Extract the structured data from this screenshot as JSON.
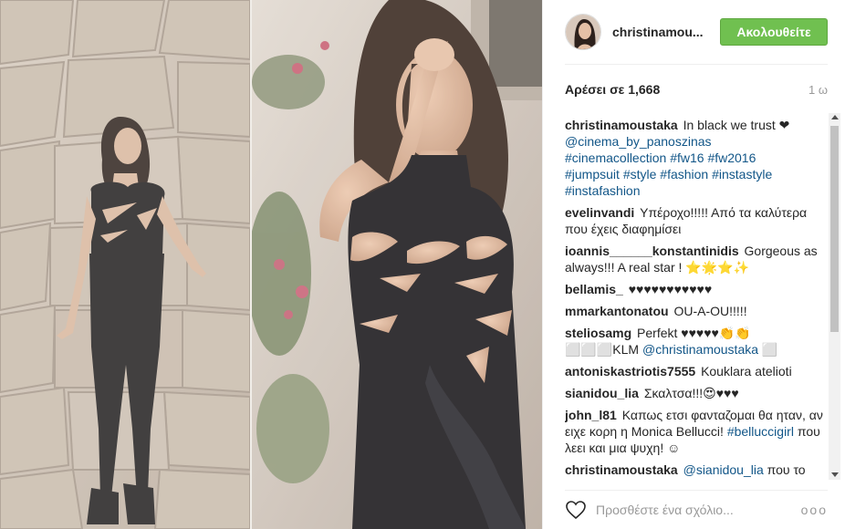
{
  "post": {
    "username": "christinamou...",
    "follow_label": "Ακολουθείτε",
    "likes": "Αρέσει σε 1,668",
    "time": "1 ω"
  },
  "comments": [
    {
      "author": "christinamoustaka",
      "parts": [
        {
          "t": "In black we trust ❤"
        },
        {
          "br": true
        },
        {
          "tag": "@cinema_by_panoszinas"
        },
        {
          "br": true
        },
        {
          "tag": "#cinemacollection"
        },
        {
          "t": " "
        },
        {
          "tag": "#fw16"
        },
        {
          "t": " "
        },
        {
          "tag": "#fw2016"
        },
        {
          "br": true
        },
        {
          "tag": "#jumpsuit"
        },
        {
          "t": " "
        },
        {
          "tag": "#style"
        },
        {
          "t": " "
        },
        {
          "tag": "#fashion"
        },
        {
          "t": " "
        },
        {
          "tag": "#instastyle"
        },
        {
          "br": true
        },
        {
          "tag": "#instafashion"
        }
      ]
    },
    {
      "author": "evelinvandi",
      "parts": [
        {
          "t": "Υπέροχο!!!!! Από τα καλύτερα που έχεις διαφημίσει"
        }
      ]
    },
    {
      "author": "ioannis______konstantinidis",
      "parts": [
        {
          "t": "Gorgeous as always!!! A real star ! ⭐🌟⭐✨"
        }
      ]
    },
    {
      "author": "bellamis_",
      "parts": [
        {
          "t": "♥♥♥♥♥♥♥♥♥♥♥"
        }
      ]
    },
    {
      "author": "mmarkantonatou",
      "parts": [
        {
          "t": "OU-A-OU!!!!!"
        }
      ]
    },
    {
      "author": "steliosamg",
      "parts": [
        {
          "t": "Perfekt ♥♥♥♥♥👏👏⬜⬜⬜KLM "
        },
        {
          "tag": "@christinamoustaka"
        },
        {
          "t": " ⬜"
        }
      ]
    },
    {
      "author": "antoniskastriotis7555",
      "parts": [
        {
          "t": "Kouklara atelioti"
        }
      ]
    },
    {
      "author": "sianidou_lia",
      "parts": [
        {
          "t": "Σκαλτσα!!!😍♥♥♥"
        }
      ]
    },
    {
      "author": "john_l81",
      "parts": [
        {
          "t": "Καπως ετσι φανταζομαι θα ηταν, αν ειχε κορη η Monica Bellucci! "
        },
        {
          "tag": "#belluccigirl"
        },
        {
          "t": " που λεει και μια ψυχη! ☺"
        }
      ]
    },
    {
      "author": "christinamoustaka",
      "parts": [
        {
          "tag": "@sianidou_lia"
        },
        {
          "t": " που το"
        }
      ]
    }
  ],
  "footer": {
    "placeholder": "Προσθέστε ένα σχόλιο...",
    "more": "ooo"
  },
  "icons": {
    "like": "heart-outline-icon",
    "more": "more-options-icon"
  },
  "colors": {
    "follow_bg": "#70c050",
    "tag": "#125688",
    "text": "#262626",
    "muted": "#999999"
  }
}
